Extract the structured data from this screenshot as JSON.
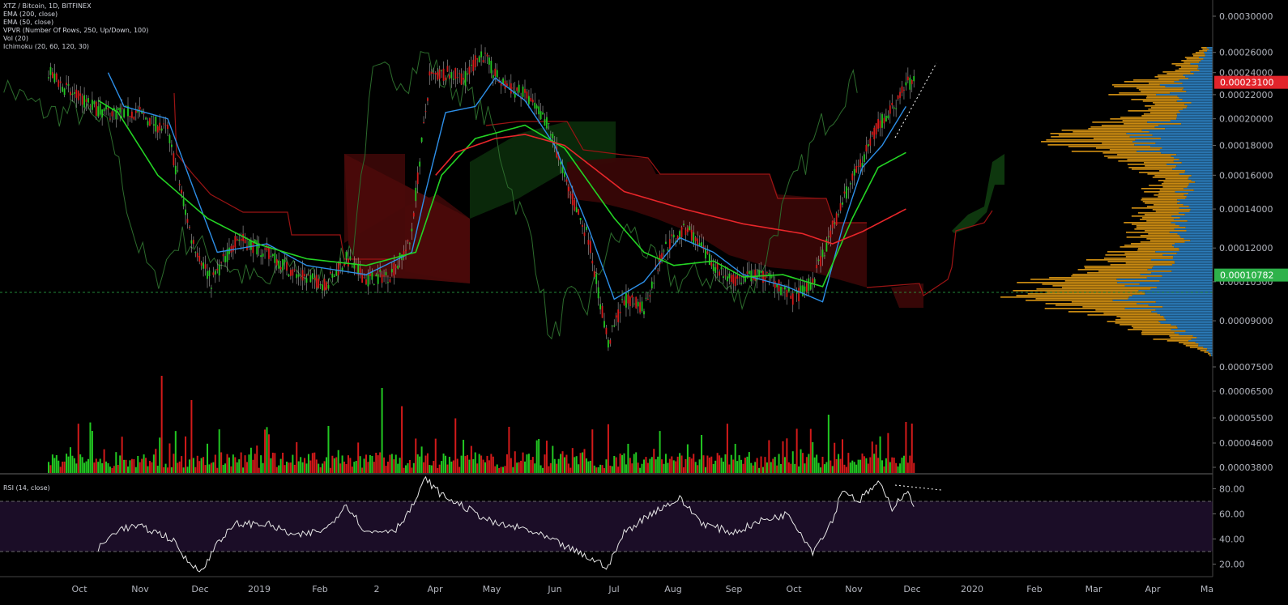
{
  "legend": {
    "pair": "XTZ / Bitcoin, 1D, BITFINEX",
    "ema200": "EMA (200, close)",
    "ema50": "EMA (50, close)",
    "vpvr": "VPVR (Number Of Rows, 250, Up/Down, 100)",
    "vol": "Vol (20)",
    "ichimoku": "Ichimoku (20, 60, 120, 30)"
  },
  "rsi_title": "RSI (14, close)",
  "colors": {
    "up": "#22c722",
    "down": "#d31a1a",
    "ema200": "#e8262a",
    "ema50": "#24d424",
    "tenkan": "#2d8fe8",
    "vpvr_up": "#2b7bb9",
    "vpvr_down": "#c98a12",
    "price_badge": "#e2242b",
    "poc_badge": "#2eb24a",
    "rsi_band": "#1b0d27"
  },
  "chart_data": [
    {
      "type": "candlestick",
      "title": "XTZ / Bitcoin, 1D, BITFINEX",
      "x_labels": [
        "Oct",
        "Nov",
        "Dec",
        "2019",
        "Feb",
        "2",
        "Apr",
        "May",
        "Jun",
        "Jul",
        "Aug",
        "Sep",
        "Oct",
        "Nov",
        "Dec",
        "2020",
        "Feb",
        "Mar",
        "Apr",
        "Ma"
      ],
      "y_ticks": [
        "0.00030000",
        "0.00026000",
        "0.00024000",
        "0.00022000",
        "0.00020000",
        "0.00018000",
        "0.00016000",
        "0.00014000",
        "0.00012000",
        "0.00010500",
        "0.00009000",
        "0.00007500",
        "0.00006500",
        "0.00005500",
        "0.00004600",
        "0.00003800"
      ],
      "y_scale": "log",
      "last_price": "0.00023100",
      "poc_price": "0.00010782",
      "close_path": [
        [
          0,
          0.00024
        ],
        [
          12,
          0.00022
        ],
        [
          28,
          0.000205
        ],
        [
          45,
          0.000205
        ],
        [
          60,
          0.00019
        ],
        [
          72,
          0.000125
        ],
        [
          82,
          0.000105
        ],
        [
          95,
          0.000125
        ],
        [
          110,
          0.000118
        ],
        [
          125,
          0.000108
        ],
        [
          140,
          0.000104
        ],
        [
          150,
          0.000115
        ],
        [
          160,
          0.000106
        ],
        [
          172,
          0.000108
        ],
        [
          182,
          0.000122
        ],
        [
          192,
          0.000235
        ],
        [
          200,
          0.00024
        ],
        [
          210,
          0.000235
        ],
        [
          218,
          0.00026
        ],
        [
          228,
          0.00023
        ],
        [
          240,
          0.00022
        ],
        [
          252,
          0.000195
        ],
        [
          262,
          0.00015
        ],
        [
          272,
          0.000125
        ],
        [
          282,
          8.2e-05
        ],
        [
          290,
          9.8e-05
        ],
        [
          300,
          9.5e-05
        ],
        [
          310,
          0.00012
        ],
        [
          322,
          0.00013
        ],
        [
          332,
          0.000115
        ],
        [
          345,
          0.000105
        ],
        [
          355,
          0.000108
        ],
        [
          365,
          0.000106
        ],
        [
          375,
          9.8e-05
        ],
        [
          385,
          0.000105
        ],
        [
          395,
          0.00013
        ],
        [
          402,
          0.00015
        ],
        [
          410,
          0.00017
        ],
        [
          418,
          0.000195
        ],
        [
          426,
          0.00021
        ],
        [
          432,
          0.00023
        ]
      ],
      "ema50_path": [
        [
          25,
          0.000215
        ],
        [
          35,
          0.000205
        ],
        [
          55,
          0.00016
        ],
        [
          80,
          0.000135
        ],
        [
          105,
          0.000122
        ],
        [
          130,
          0.000115
        ],
        [
          160,
          0.000112
        ],
        [
          185,
          0.000118
        ],
        [
          198,
          0.00016
        ],
        [
          215,
          0.000185
        ],
        [
          240,
          0.000195
        ],
        [
          260,
          0.000178
        ],
        [
          285,
          0.000135
        ],
        [
          300,
          0.000118
        ],
        [
          315,
          0.000112
        ],
        [
          335,
          0.000114
        ],
        [
          350,
          0.000107
        ],
        [
          370,
          0.000108
        ],
        [
          390,
          0.000103
        ],
        [
          405,
          0.000135
        ],
        [
          418,
          0.000165
        ],
        [
          432,
          0.000175
        ]
      ],
      "ema200_path": [
        [
          195,
          0.00016
        ],
        [
          205,
          0.000175
        ],
        [
          225,
          0.000185
        ],
        [
          240,
          0.000188
        ],
        [
          260,
          0.00018
        ],
        [
          290,
          0.00015
        ],
        [
          320,
          0.00014
        ],
        [
          350,
          0.000132
        ],
        [
          380,
          0.000127
        ],
        [
          395,
          0.000122
        ],
        [
          410,
          0.000128
        ],
        [
          432,
          0.00014
        ]
      ],
      "tenkan_path": [
        [
          30,
          0.00024
        ],
        [
          38,
          0.00021
        ],
        [
          60,
          0.0002
        ],
        [
          72,
          0.000155
        ],
        [
          85,
          0.000118
        ],
        [
          110,
          0.000122
        ],
        [
          130,
          0.000112
        ],
        [
          160,
          0.000108
        ],
        [
          183,
          0.000118
        ],
        [
          190,
          0.00015
        ],
        [
          200,
          0.000205
        ],
        [
          215,
          0.00021
        ],
        [
          225,
          0.000235
        ],
        [
          240,
          0.000215
        ],
        [
          255,
          0.00018
        ],
        [
          272,
          0.00013
        ],
        [
          285,
          9.8e-05
        ],
        [
          300,
          0.000105
        ],
        [
          318,
          0.000125
        ],
        [
          335,
          0.000118
        ],
        [
          350,
          0.000108
        ],
        [
          372,
          0.000103
        ],
        [
          390,
          9.7e-05
        ],
        [
          400,
          0.00013
        ],
        [
          410,
          0.000165
        ],
        [
          420,
          0.00018
        ],
        [
          432,
          0.00021
        ]
      ],
      "volume": {
        "ylim_note": "relative volume in pane",
        "spikes": [
          {
            "pos": 57,
            "value": 0.8,
            "dir": "down"
          },
          {
            "pos": 72,
            "value": 0.6,
            "dir": "down"
          },
          {
            "pos": 168,
            "value": 0.7,
            "dir": "up"
          },
          {
            "pos": 178,
            "value": 0.55,
            "dir": "down"
          },
          {
            "pos": 205,
            "value": 0.45,
            "dir": "down"
          },
          {
            "pos": 393,
            "value": 0.48,
            "dir": "up"
          },
          {
            "pos": 432,
            "value": 0.42,
            "dir": "down"
          }
        ]
      },
      "rsi": {
        "ylim": [
          10,
          90
        ],
        "ticks": [
          "80.00",
          "60.00",
          "40.00",
          "20.00"
        ],
        "overbought": 70,
        "oversold": 30,
        "path": [
          [
            25,
            32
          ],
          [
            35,
            48
          ],
          [
            45,
            50
          ],
          [
            55,
            45
          ],
          [
            62,
            40
          ],
          [
            70,
            22
          ],
          [
            78,
            15
          ],
          [
            85,
            38
          ],
          [
            95,
            52
          ],
          [
            110,
            52
          ],
          [
            125,
            42
          ],
          [
            140,
            48
          ],
          [
            150,
            68
          ],
          [
            160,
            45
          ],
          [
            175,
            48
          ],
          [
            183,
            65
          ],
          [
            190,
            88
          ],
          [
            198,
            75
          ],
          [
            210,
            65
          ],
          [
            225,
            52
          ],
          [
            240,
            48
          ],
          [
            255,
            38
          ],
          [
            272,
            25
          ],
          [
            282,
            18
          ],
          [
            290,
            45
          ],
          [
            305,
            62
          ],
          [
            318,
            72
          ],
          [
            330,
            52
          ],
          [
            345,
            45
          ],
          [
            360,
            55
          ],
          [
            373,
            60
          ],
          [
            385,
            30
          ],
          [
            395,
            55
          ],
          [
            400,
            80
          ],
          [
            408,
            70
          ],
          [
            418,
            85
          ],
          [
            425,
            65
          ],
          [
            432,
            78
          ],
          [
            436,
            68
          ]
        ]
      }
    }
  ]
}
